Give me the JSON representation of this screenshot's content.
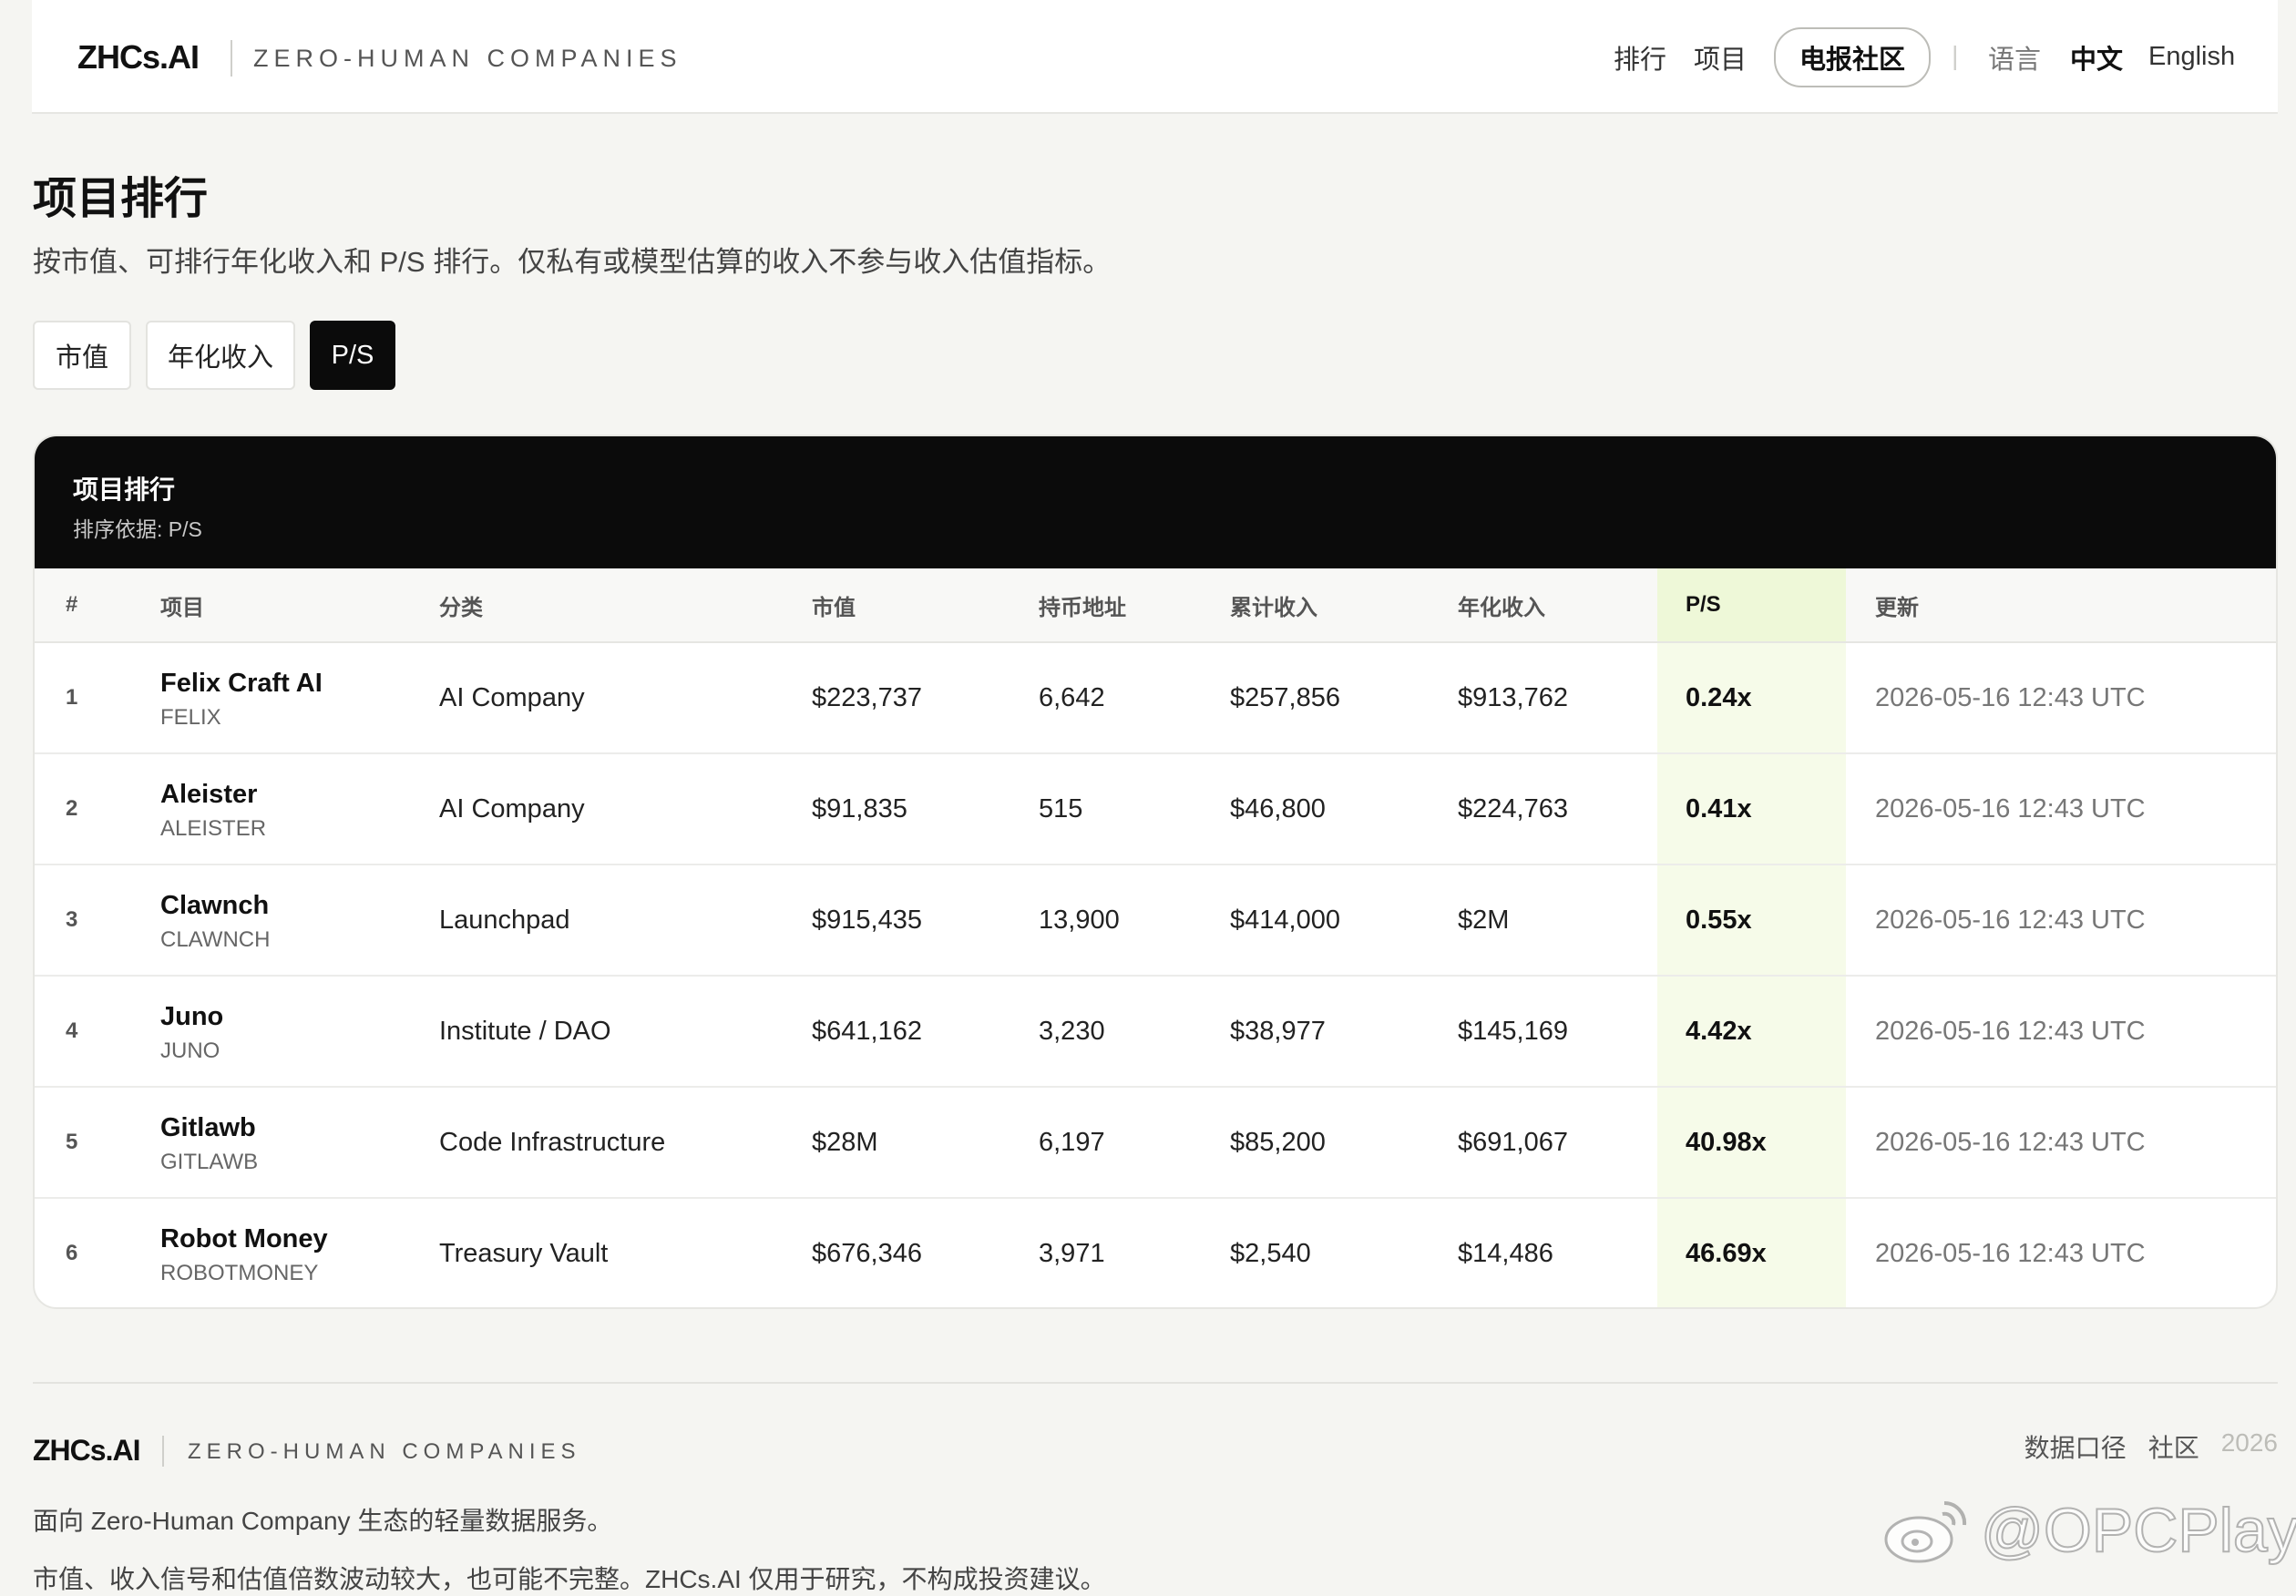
{
  "header": {
    "brand": "ZHCs.AI",
    "tagline": "ZERO-HUMAN COMPANIES",
    "nav": {
      "rank": "排行",
      "projects": "项目",
      "community": "电报社区"
    },
    "separator": "|",
    "lang": {
      "label": "语言",
      "zh": "中文",
      "en": "English"
    }
  },
  "page": {
    "title": "项目排行",
    "description": "按市值、可排行年化收入和 P/S 排行。仅私有或模型估算的收入不参与收入估值指标。"
  },
  "tabs": [
    {
      "label": "市值",
      "active": false
    },
    {
      "label": "年化收入",
      "active": false
    },
    {
      "label": "P/S",
      "active": true
    }
  ],
  "table": {
    "title": "项目排行",
    "subtitle": "排序依据: P/S",
    "columns": [
      "#",
      "项目",
      "分类",
      "市值",
      "持币地址",
      "累计收入",
      "年化收入",
      "P/S",
      "更新"
    ],
    "rows": [
      {
        "rank": "1",
        "name": "Felix Craft AI",
        "symbol": "FELIX",
        "category": "AI Company",
        "market_cap": "$223,737",
        "holders": "6,642",
        "cum_revenue": "$257,856",
        "annual_revenue": "$913,762",
        "ps": "0.24x",
        "updated": "2026-05-16 12:43 UTC"
      },
      {
        "rank": "2",
        "name": "Aleister",
        "symbol": "ALEISTER",
        "category": "AI Company",
        "market_cap": "$91,835",
        "holders": "515",
        "cum_revenue": "$46,800",
        "annual_revenue": "$224,763",
        "ps": "0.41x",
        "updated": "2026-05-16 12:43 UTC"
      },
      {
        "rank": "3",
        "name": "Clawnch",
        "symbol": "CLAWNCH",
        "category": "Launchpad",
        "market_cap": "$915,435",
        "holders": "13,900",
        "cum_revenue": "$414,000",
        "annual_revenue": "$2M",
        "ps": "0.55x",
        "updated": "2026-05-16 12:43 UTC"
      },
      {
        "rank": "4",
        "name": "Juno",
        "symbol": "JUNO",
        "category": "Institute / DAO",
        "market_cap": "$641,162",
        "holders": "3,230",
        "cum_revenue": "$38,977",
        "annual_revenue": "$145,169",
        "ps": "4.42x",
        "updated": "2026-05-16 12:43 UTC"
      },
      {
        "rank": "5",
        "name": "Gitlawb",
        "symbol": "GITLAWB",
        "category": "Code Infrastructure",
        "market_cap": "$28M",
        "holders": "6,197",
        "cum_revenue": "$85,200",
        "annual_revenue": "$691,067",
        "ps": "40.98x",
        "updated": "2026-05-16 12:43 UTC"
      },
      {
        "rank": "6",
        "name": "Robot Money",
        "symbol": "ROBOTMONEY",
        "category": "Treasury Vault",
        "market_cap": "$676,346",
        "holders": "3,971",
        "cum_revenue": "$2,540",
        "annual_revenue": "$14,486",
        "ps": "46.69x",
        "updated": "2026-05-16 12:43 UTC"
      }
    ]
  },
  "footer": {
    "brand": "ZHCs.AI",
    "tagline": "ZERO-HUMAN COMPANIES",
    "links": {
      "methodology": "数据口径",
      "community": "社区",
      "year": "2026"
    },
    "line1": "面向 Zero-Human Company 生态的轻量数据服务。",
    "line2": "市值、收入信号和估值倍数波动较大，也可能不完整。ZHCs.AI 仅用于研究，不构成投资建议。"
  },
  "watermark": {
    "text": "@OPCPlay",
    "icon": "weibo-icon"
  },
  "colors": {
    "accent_dark": "#0b0b0b",
    "ps_highlight": "#f6fbe9",
    "background": "#f5f5f2"
  }
}
